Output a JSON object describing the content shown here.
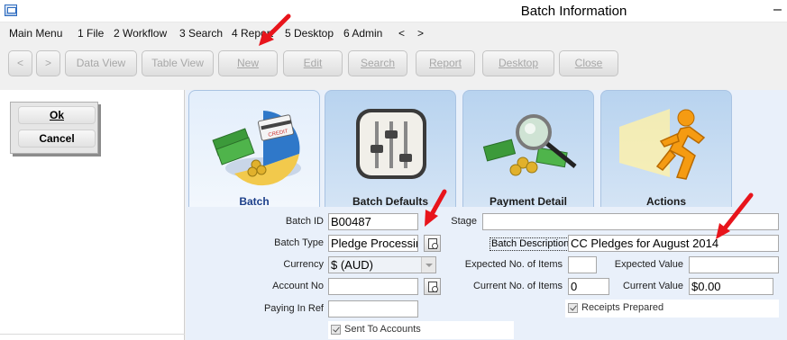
{
  "window": {
    "title": "Batch Information",
    "minimize": "–"
  },
  "menu": [
    {
      "label": "Main Menu"
    },
    {
      "label": "1 File"
    },
    {
      "label": "2 Workflow"
    },
    {
      "label": "3 Search"
    },
    {
      "label": "4 Report"
    },
    {
      "label": "5 Desktop"
    },
    {
      "label": "6 Admin"
    },
    {
      "label": "<"
    },
    {
      "label": ">"
    }
  ],
  "toolbar": {
    "back": "<",
    "forward": ">",
    "data_view": "Data View",
    "table_view": "Table View",
    "new": "New",
    "edit": "Edit",
    "search": "Search",
    "report": "Report",
    "desktop": "Desktop",
    "close": "Close"
  },
  "actions": {
    "ok": "Ok",
    "cancel": "Cancel"
  },
  "tabs": [
    {
      "label": "Batch",
      "icon": "money-credit-card-icon",
      "active": true
    },
    {
      "label": "Batch Defaults",
      "icon": "sliders-icon"
    },
    {
      "label": "Payment Detail",
      "icon": "magnifier-money-icon"
    },
    {
      "label": "Actions",
      "icon": "running-man-icon"
    }
  ],
  "form": {
    "batch_id_label": "Batch ID",
    "batch_id": "B00487",
    "batch_type_label": "Batch Type",
    "batch_type": "Pledge Processing",
    "currency_label": "Currency",
    "currency": "$ (AUD)",
    "account_no_label": "Account No",
    "account_no": "",
    "paying_in_ref_label": "Paying In Ref",
    "paying_in_ref": "",
    "sent_to_accounts_label": "Sent To Accounts",
    "stage_label": "Stage",
    "stage": "",
    "batch_description_label": "Batch Description",
    "batch_description": "CC Pledges for August 2014",
    "expected_items_label": "Expected No. of Items",
    "expected_items": "",
    "expected_value_label": "Expected Value",
    "expected_value": "",
    "current_items_label": "Current No. of Items",
    "current_items": "0",
    "current_value_label": "Current Value",
    "current_value": "$0.00",
    "receipts_prepared_label": "Receipts Prepared"
  },
  "colors": {
    "annotation_arrow": "#e8141b",
    "tab_active_text": "#1c3f8a",
    "panel_bg": "#e9f0fa"
  }
}
